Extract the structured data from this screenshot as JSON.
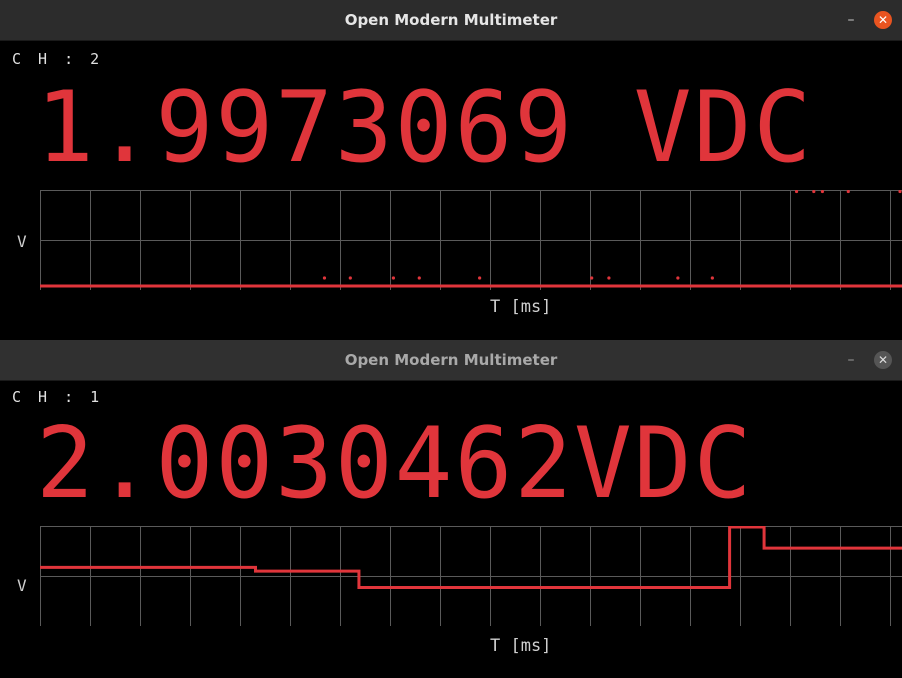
{
  "windows": [
    {
      "title": "Open Modern Multimeter",
      "channel": "C H : 2",
      "reading": "1.9973069 VDC",
      "y_axis": "V",
      "x_axis": "T [ms]",
      "controls": {
        "minimize": "–",
        "close": "✕"
      },
      "trace": {
        "baseline_level": 0,
        "scattered_points_near_baseline": [
          0.33,
          0.36,
          0.41,
          0.44,
          0.51,
          0.64,
          0.66,
          0.74,
          0.78
        ],
        "scattered_points_top": [
          0.88,
          0.9,
          0.91,
          0.94,
          1.0
        ]
      }
    },
    {
      "title": "Open Modern Multimeter",
      "channel": "C H : 1",
      "reading": "2.0030462VDC",
      "y_axis": "V",
      "x_axis": "T [ms]",
      "controls": {
        "minimize": "–",
        "close": "✕"
      },
      "trace": {
        "segments": [
          {
            "from": 0.0,
            "to": 0.25,
            "level": 0.58
          },
          {
            "from": 0.25,
            "to": 0.37,
            "level": 0.54
          },
          {
            "from": 0.37,
            "to": 0.8,
            "level": 0.37
          },
          {
            "from": 0.8,
            "to": 0.84,
            "level": 1.0
          },
          {
            "from": 0.84,
            "to": 1.0,
            "level": 0.78
          }
        ]
      }
    }
  ],
  "colors": {
    "reading": "#e0353b",
    "trace": "#e0353b",
    "grid": "#5a5a5a",
    "close_active": "#e95420"
  }
}
